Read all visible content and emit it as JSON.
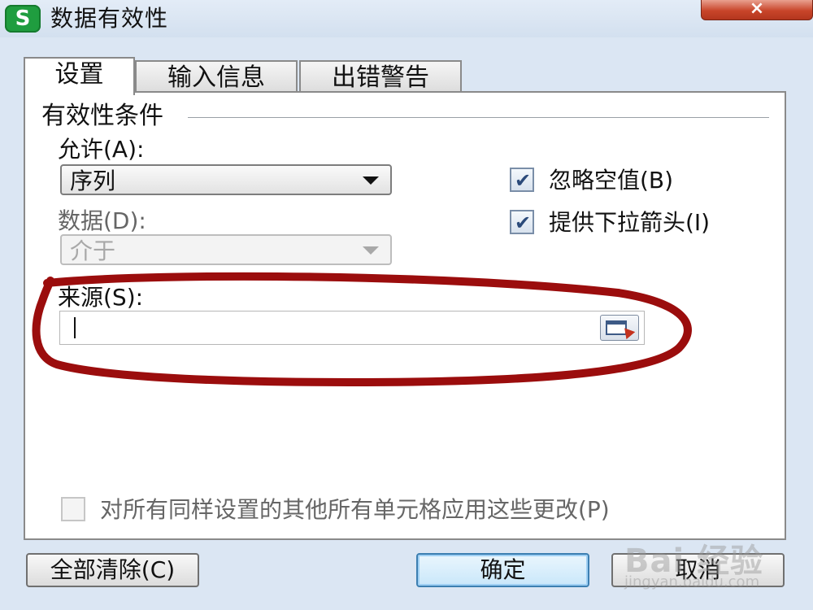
{
  "window": {
    "title": "数据有效性",
    "app_icon_letter": "S",
    "close_symbol": "×"
  },
  "tabs": [
    {
      "label": "设置",
      "active": true
    },
    {
      "label": "输入信息",
      "active": false
    },
    {
      "label": "出错警告",
      "active": false
    }
  ],
  "validation": {
    "group_title": "有效性条件",
    "allow_label": "允许(A):",
    "allow_value": "序列",
    "data_label": "数据(D):",
    "data_value": "介于",
    "ignore_blank_label": "忽略空值(B)",
    "ignore_blank_checked": true,
    "dropdown_label": "提供下拉箭头(I)",
    "dropdown_checked": true,
    "source_label": "来源(S):",
    "source_value": "",
    "apply_all_label": "对所有同样设置的其他所有单元格应用这些更改(P)",
    "apply_all_checked": false
  },
  "buttons": {
    "clear_all": "全部清除(C)",
    "ok": "确定",
    "cancel": "取消"
  },
  "watermark": {
    "main": "Bai 经验",
    "sub": "jingyan.baidu.com"
  },
  "colors": {
    "annotation_circle": "#9b0d0d",
    "app_icon": "#1f9d3f",
    "close_button": "#c8452a"
  }
}
